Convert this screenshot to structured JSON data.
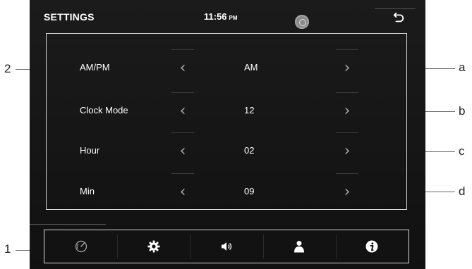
{
  "header": {
    "title": "SETTINGS",
    "time": "11:56",
    "time_suffix": "PM"
  },
  "settings": [
    {
      "label": "AM/PM",
      "value": "AM"
    },
    {
      "label": "Clock Mode",
      "value": "12"
    },
    {
      "label": "Hour",
      "value": "02"
    },
    {
      "label": "Min",
      "value": "09"
    }
  ],
  "arrows": {
    "left": "‹",
    "right": "›"
  },
  "bottom_nav": [
    {
      "icon": "speedometer-icon"
    },
    {
      "icon": "gear-icon"
    },
    {
      "icon": "speaker-icon"
    },
    {
      "icon": "user-icon"
    },
    {
      "icon": "info-icon"
    }
  ],
  "callouts": {
    "panel": "2",
    "nav": "1",
    "row_a": "a",
    "row_b": "b",
    "row_c": "c",
    "row_d": "d"
  }
}
